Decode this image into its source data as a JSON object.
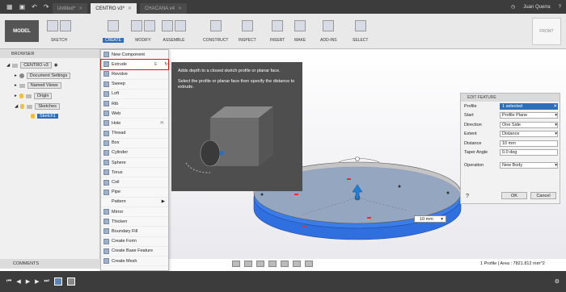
{
  "tabs": [
    {
      "label": "Untitled*"
    },
    {
      "label": "CENTRO v3*"
    },
    {
      "label": "CHACANA v4"
    }
  ],
  "user": {
    "name": "Juan Querra"
  },
  "toolbar": {
    "workspace": "MODEL",
    "groups": [
      "SKETCH",
      "CREATE",
      "MODIFY",
      "ASSEMBLE",
      "CONSTRUCT",
      "INSPECT",
      "INSERT",
      "MAKE",
      "ADD-INS",
      "SELECT"
    ]
  },
  "viewcube": {
    "label": "FRONT"
  },
  "browser": {
    "title": "BROWSER",
    "root": "CENTRO v3",
    "items": [
      "Document Settings",
      "Named Views",
      "Origin",
      "Sketches",
      "Sketch1"
    ]
  },
  "create_menu": {
    "items": [
      {
        "label": "New Component",
        "key": ""
      },
      {
        "label": "Extrude",
        "key": "E"
      },
      {
        "label": "Revolve",
        "key": ""
      },
      {
        "label": "Sweep",
        "key": ""
      },
      {
        "label": "Loft",
        "key": ""
      },
      {
        "label": "Rib",
        "key": ""
      },
      {
        "label": "Web",
        "key": ""
      },
      {
        "label": "Hole",
        "key": "H"
      },
      {
        "label": "Thread",
        "key": ""
      },
      {
        "label": "Box",
        "key": ""
      },
      {
        "label": "Cylinder",
        "key": ""
      },
      {
        "label": "Sphere",
        "key": ""
      },
      {
        "label": "Torus",
        "key": ""
      },
      {
        "label": "Coil",
        "key": ""
      },
      {
        "label": "Pipe",
        "key": ""
      },
      {
        "label": "Pattern",
        "key": ""
      },
      {
        "label": "Mirror",
        "key": ""
      },
      {
        "label": "Thicken",
        "key": ""
      },
      {
        "label": "Boundary Fill",
        "key": ""
      },
      {
        "label": "Create Form",
        "key": ""
      },
      {
        "label": "Create Base Feature",
        "key": ""
      },
      {
        "label": "Create Mesh",
        "key": ""
      }
    ]
  },
  "tooltip": {
    "line1": "Adds depth to a closed sketch profile or planar face.",
    "line2": "Select the profile or planar face then specify the distance to extrude."
  },
  "edit_feature": {
    "title": "EDIT FEATURE",
    "rows": [
      {
        "label": "Profile",
        "value": "1 selected"
      },
      {
        "label": "Start",
        "value": "Profile Plane"
      },
      {
        "label": "Direction",
        "value": "One Side"
      },
      {
        "label": "Extent",
        "value": "Distance"
      },
      {
        "label": "Distance",
        "value": "10 mm"
      },
      {
        "label": "Taper Angle",
        "value": "0.0 deg"
      },
      {
        "label": "Operation",
        "value": "New Body"
      }
    ],
    "ok": "OK",
    "cancel": "Cancel"
  },
  "dimension_input": "10 mm",
  "comments": "COMMENTS",
  "status": "1 Profile | Area : 7821.812 mm^2",
  "colors": {
    "accent": "#2f6db5",
    "highlight": "#d02020",
    "face": "#2f6fe0"
  }
}
